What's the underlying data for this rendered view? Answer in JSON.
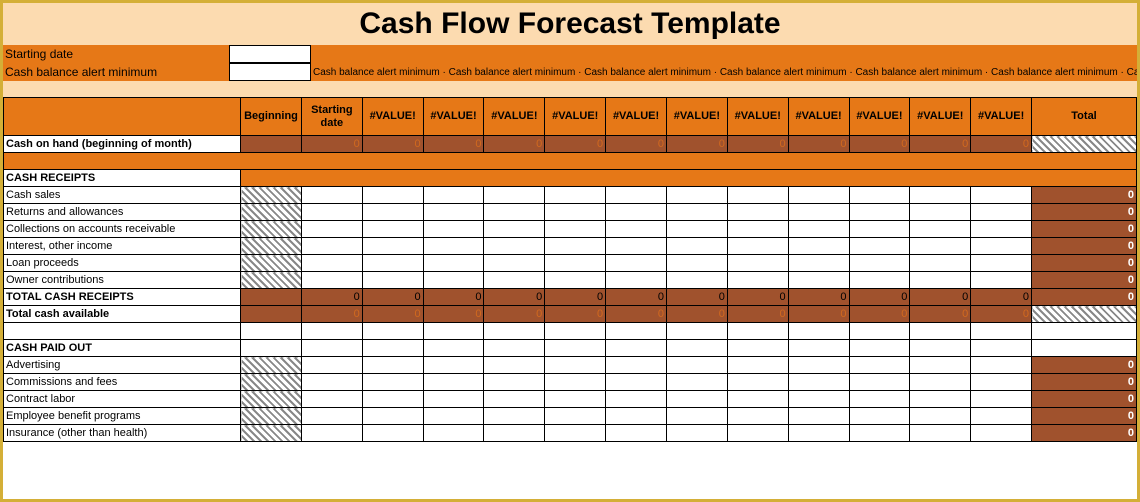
{
  "title": "Cash Flow Forecast Template",
  "inputs": {
    "starting_date_label": "Starting date",
    "alert_min_label": "Cash balance alert minimum",
    "repeat_text": "Cash balance alert minimum"
  },
  "headers": {
    "blank": "",
    "beginning": "Beginning",
    "starting_date": "Starting date",
    "value_err": "#VALUE!",
    "total": "Total"
  },
  "rows": {
    "cash_on_hand": "Cash on hand (beginning of month)",
    "cash_receipts": "CASH RECEIPTS",
    "cash_sales": "Cash sales",
    "returns": "Returns and allowances",
    "collections": "Collections on accounts receivable",
    "interest": "Interest, other income",
    "loan": "Loan proceeds",
    "owner": "Owner contributions",
    "total_receipts": "TOTAL CASH RECEIPTS",
    "total_available": "Total cash available",
    "cash_paid_out": "CASH PAID OUT",
    "advertising": "Advertising",
    "commissions": "Commissions and fees",
    "contract": "Contract labor",
    "employee": "Employee benefit programs",
    "insurance": "Insurance (other than health)"
  },
  "vals": {
    "zero": "0",
    "zero_orange": "0"
  },
  "chart_data": {
    "type": "table",
    "title": "Cash Flow Forecast Template",
    "columns": [
      "Beginning",
      "Starting date",
      "#VALUE!",
      "#VALUE!",
      "#VALUE!",
      "#VALUE!",
      "#VALUE!",
      "#VALUE!",
      "#VALUE!",
      "#VALUE!",
      "#VALUE!",
      "#VALUE!",
      "#VALUE!",
      "Total"
    ],
    "rows": [
      {
        "label": "Cash on hand (beginning of month)",
        "values": [
          null,
          0,
          0,
          0,
          0,
          0,
          0,
          0,
          0,
          0,
          0,
          0,
          0,
          null
        ]
      },
      {
        "label": "CASH RECEIPTS",
        "section": true
      },
      {
        "label": "Cash sales",
        "values": [
          null,
          null,
          null,
          null,
          null,
          null,
          null,
          null,
          null,
          null,
          null,
          null,
          null,
          0
        ]
      },
      {
        "label": "Returns and allowances",
        "values": [
          null,
          null,
          null,
          null,
          null,
          null,
          null,
          null,
          null,
          null,
          null,
          null,
          null,
          0
        ]
      },
      {
        "label": "Collections on accounts receivable",
        "values": [
          null,
          null,
          null,
          null,
          null,
          null,
          null,
          null,
          null,
          null,
          null,
          null,
          null,
          0
        ]
      },
      {
        "label": "Interest, other income",
        "values": [
          null,
          null,
          null,
          null,
          null,
          null,
          null,
          null,
          null,
          null,
          null,
          null,
          null,
          0
        ]
      },
      {
        "label": "Loan proceeds",
        "values": [
          null,
          null,
          null,
          null,
          null,
          null,
          null,
          null,
          null,
          null,
          null,
          null,
          null,
          0
        ]
      },
      {
        "label": "Owner contributions",
        "values": [
          null,
          null,
          null,
          null,
          null,
          null,
          null,
          null,
          null,
          null,
          null,
          null,
          null,
          0
        ]
      },
      {
        "label": "TOTAL CASH RECEIPTS",
        "values": [
          null,
          0,
          0,
          0,
          0,
          0,
          0,
          0,
          0,
          0,
          0,
          0,
          0,
          0
        ]
      },
      {
        "label": "Total cash available",
        "values": [
          null,
          0,
          0,
          0,
          0,
          0,
          0,
          0,
          0,
          0,
          0,
          0,
          0,
          null
        ]
      },
      {
        "label": "CASH PAID OUT",
        "section": true
      },
      {
        "label": "Advertising",
        "values": [
          null,
          null,
          null,
          null,
          null,
          null,
          null,
          null,
          null,
          null,
          null,
          null,
          null,
          0
        ]
      },
      {
        "label": "Commissions and fees",
        "values": [
          null,
          null,
          null,
          null,
          null,
          null,
          null,
          null,
          null,
          null,
          null,
          null,
          null,
          0
        ]
      },
      {
        "label": "Contract labor",
        "values": [
          null,
          null,
          null,
          null,
          null,
          null,
          null,
          null,
          null,
          null,
          null,
          null,
          null,
          0
        ]
      },
      {
        "label": "Employee benefit programs",
        "values": [
          null,
          null,
          null,
          null,
          null,
          null,
          null,
          null,
          null,
          null,
          null,
          null,
          null,
          0
        ]
      }
    ]
  }
}
